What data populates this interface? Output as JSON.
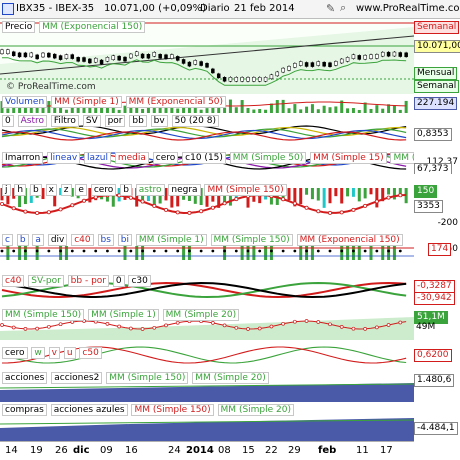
{
  "header": {
    "symbol": "IBX35 - IBEX-35",
    "quote": "10.071,00 (+0,09%)",
    "period": "Diario",
    "date": "21 feb 2014",
    "site": "www.ProRealTime.com"
  },
  "price_panel": {
    "labels": [
      "Precio",
      "MM (Exponencial 150)"
    ],
    "watermark": "© ProRealTime.com",
    "tags": {
      "weekly": "Semanal",
      "last": "10.071,00",
      "monthly": "Mensual",
      "weekly2": "Semanal"
    }
  },
  "volume_panel": {
    "labels": [
      "Volumen",
      "MM (Simple 1)",
      "MM (Exponencial 50)"
    ],
    "value": "227.194"
  },
  "astro_panel": {
    "labels": [
      "0",
      "Astro",
      "Filtro",
      "SV",
      "por",
      "bb",
      "bv",
      "50 (20 8)"
    ],
    "value": "0,8353"
  },
  "imarron_panel": {
    "labels": [
      "Imarron",
      "lineav",
      "lazul",
      "media",
      "cero",
      "c10 (15)",
      "MM (Simple 50)",
      "MM (Simple 15)",
      "MM (Simple 15)"
    ],
    "value_top": "112,37",
    "value": "67,373"
  },
  "j_panel": {
    "labels": [
      "j",
      "h",
      "b",
      "x",
      "z",
      "e",
      "cero",
      "b",
      "astro",
      "negra",
      "MM (Simple 150)"
    ],
    "value_top": "150",
    "value": "3353",
    "value_bottom": "-200"
  },
  "c_panel": {
    "labels": [
      "c",
      "b",
      "a",
      "div",
      "c40",
      "bs",
      "bi",
      "MM (Simple 1)",
      "MM (Simple 150)",
      "MM (Exponencial 150)"
    ],
    "value_top": "50",
    "value": "174"
  },
  "c40_panel": {
    "labels": [
      "c40",
      "SV-por",
      "bb - por",
      "0",
      "c30"
    ],
    "value": "-0,3287",
    "value2": "-30,942"
  },
  "mm_panel": {
    "labels": [
      "MM (Simple 150)",
      "MM (Simple 1)",
      "MM (Simple 20)"
    ],
    "value": "51,1M",
    "value2": "49M"
  },
  "cero_panel": {
    "labels": [
      "cero",
      "w",
      "v",
      "u",
      "c50"
    ],
    "value": "0,6200"
  },
  "acciones_panel": {
    "labels": [
      "acciones",
      "acciones2",
      "MM (Simple 150)",
      "MM (Simple 20)"
    ],
    "value": "1.480,6"
  },
  "compras_panel": {
    "labels": [
      "compras",
      "acciones azules",
      "MM (Simple 150)",
      "MM (Simple 20)"
    ],
    "value": "-4.484,1"
  },
  "x_axis": [
    "14",
    "19",
    "26",
    "dic",
    "09",
    "16",
    "24",
    "2014",
    "08",
    "15",
    "22",
    "29",
    "feb",
    "11",
    "17"
  ],
  "colors": {
    "green": "#3ba33b",
    "red": "#d21c1c",
    "blue": "#2047c8",
    "navy": "#4a5aa8"
  },
  "icons": [
    "wrench-icon",
    "search-icon"
  ]
}
